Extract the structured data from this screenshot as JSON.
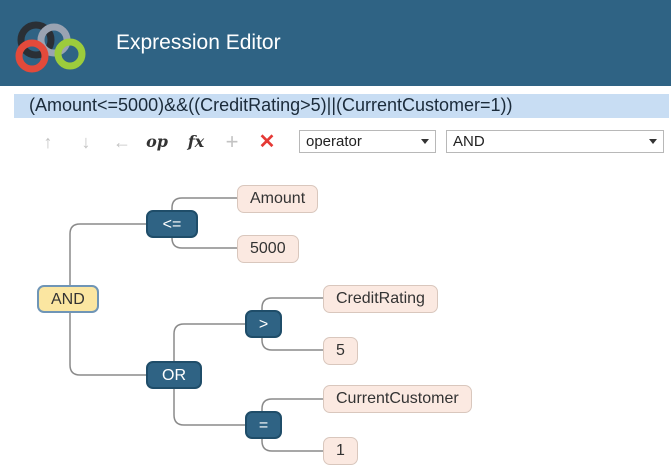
{
  "header": {
    "title": "Expression Editor"
  },
  "expression": {
    "text": "(Amount<=5000)&&((CreditRating>5)||(CurrentCustomer=1))"
  },
  "toolbar": {
    "icons": [
      "arrow-up",
      "arrow-down",
      "arrow-left",
      "op",
      "fx",
      "plus",
      "delete"
    ],
    "op_label": "op",
    "fx_label": "fx",
    "type_select": "operator",
    "value_select": "AND"
  },
  "tree": {
    "root": "AND",
    "le_op": "<=",
    "amount": "Amount",
    "amount_value": "5000",
    "or_op": "OR",
    "gt_op": ">",
    "credit_rating": "CreditRating",
    "credit_value": "5",
    "eq_op": "=",
    "current_customer": "CurrentCustomer",
    "customer_value": "1"
  },
  "colors": {
    "header": "#2f6384",
    "expression_bar": "#c8ddf3",
    "operator_node": "#2f6384",
    "leaf_node": "#fbe9e1",
    "root_node": "#fbe6a1",
    "delete": "#e53935"
  }
}
